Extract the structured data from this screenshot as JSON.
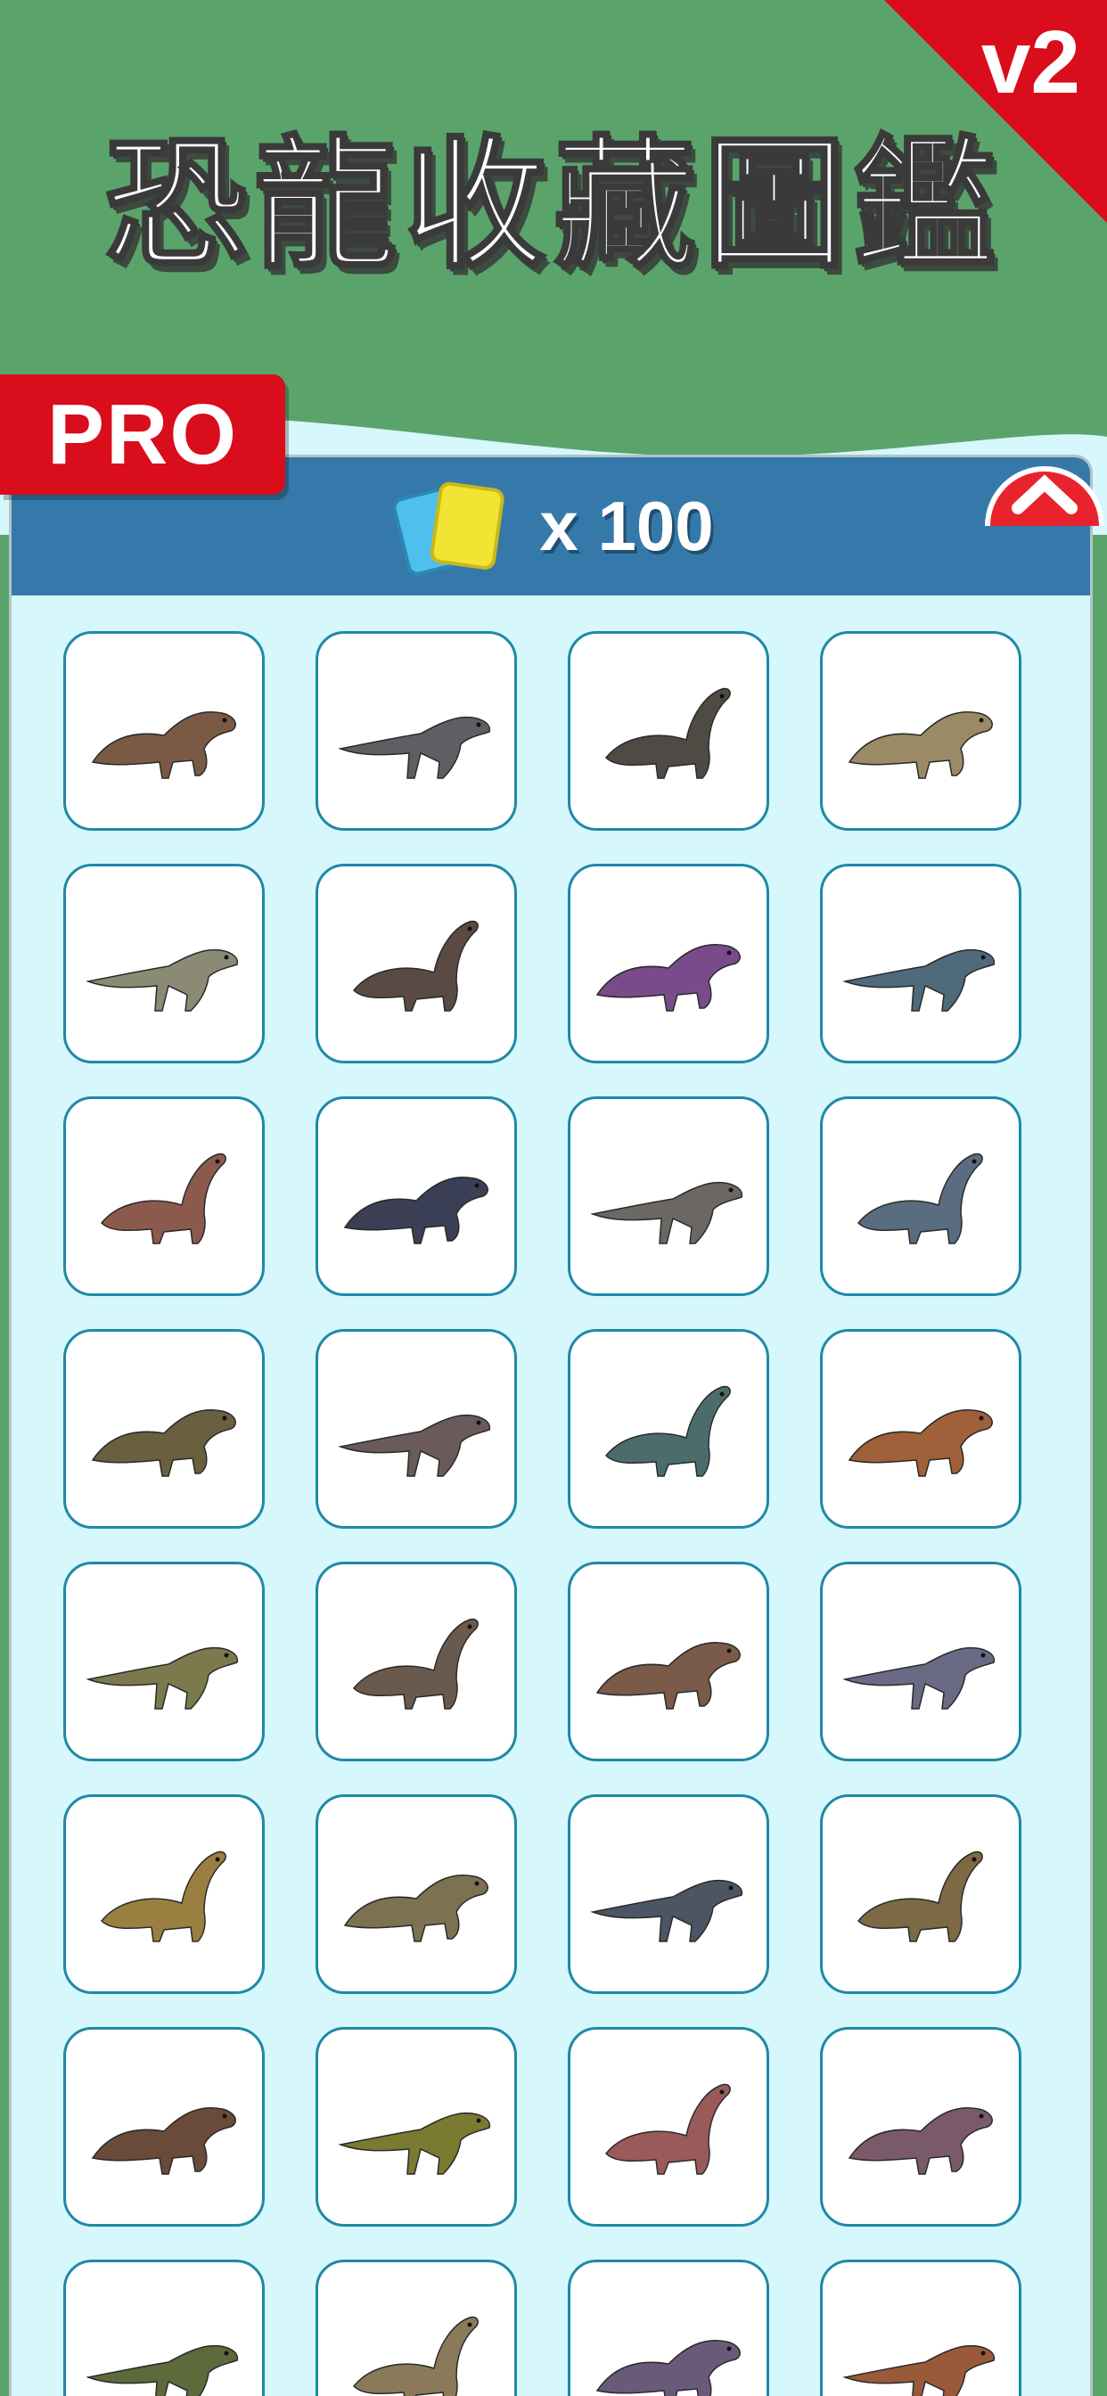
{
  "app": {
    "title": "恐龍收藏圖鑑",
    "version_badge": "v2",
    "pro_badge": "PRO"
  },
  "header": {
    "currency_icon": "cards-icon",
    "currency_label": "x 100"
  },
  "close_icon": "close-icon",
  "colors": {
    "banner_green": "#5aa46c",
    "ribbon_red": "#d90d1b",
    "header_blue": "#3479aa",
    "panel_bg": "#d6f7fb",
    "card_border": "#1f89a6"
  },
  "dinosaurs": [
    {
      "icon": "dinosaur-icon",
      "color": "#7a5a44"
    },
    {
      "icon": "dinosaur-icon",
      "color": "#5f5f63"
    },
    {
      "icon": "dinosaur-icon",
      "color": "#4f4a44"
    },
    {
      "icon": "dinosaur-icon",
      "color": "#9a8a66"
    },
    {
      "icon": "dinosaur-icon",
      "color": "#8b8b75"
    },
    {
      "icon": "dinosaur-icon",
      "color": "#5b4a44"
    },
    {
      "icon": "dinosaur-icon",
      "color": "#7a4b8a"
    },
    {
      "icon": "dinosaur-icon",
      "color": "#4f6a7a"
    },
    {
      "icon": "dinosaur-icon",
      "color": "#8c5a4c"
    },
    {
      "icon": "dinosaur-icon",
      "color": "#3a3f55"
    },
    {
      "icon": "dinosaur-icon",
      "color": "#6b6863"
    },
    {
      "icon": "dinosaur-icon",
      "color": "#5a6c80"
    },
    {
      "icon": "dinosaur-icon",
      "color": "#6a6040"
    },
    {
      "icon": "dinosaur-icon",
      "color": "#6a5a5a"
    },
    {
      "icon": "dinosaur-icon",
      "color": "#4c6c6c"
    },
    {
      "icon": "dinosaur-icon",
      "color": "#a0603a"
    },
    {
      "icon": "dinosaur-icon",
      "color": "#7c7a4c"
    },
    {
      "icon": "dinosaur-icon",
      "color": "#6a5a4e"
    },
    {
      "icon": "dinosaur-icon",
      "color": "#7a5a48"
    },
    {
      "icon": "dinosaur-icon",
      "color": "#6a6a85"
    },
    {
      "icon": "dinosaur-icon",
      "color": "#9a8040"
    },
    {
      "icon": "dinosaur-icon",
      "color": "#7d7152"
    },
    {
      "icon": "dinosaur-icon",
      "color": "#4c5563"
    },
    {
      "icon": "dinosaur-icon",
      "color": "#7c6a44"
    },
    {
      "icon": "dinosaur-icon",
      "color": "#6a4a38"
    },
    {
      "icon": "dinosaur-icon",
      "color": "#7a7a30"
    },
    {
      "icon": "dinosaur-icon",
      "color": "#9a5a5a"
    },
    {
      "icon": "dinosaur-icon",
      "color": "#7a5a6a"
    },
    {
      "icon": "dinosaur-icon",
      "color": "#5c6a3c"
    },
    {
      "icon": "dinosaur-icon",
      "color": "#8a7a5a"
    },
    {
      "icon": "dinosaur-icon",
      "color": "#6a5a7a"
    },
    {
      "icon": "dinosaur-icon",
      "color": "#9a5a3a"
    }
  ]
}
